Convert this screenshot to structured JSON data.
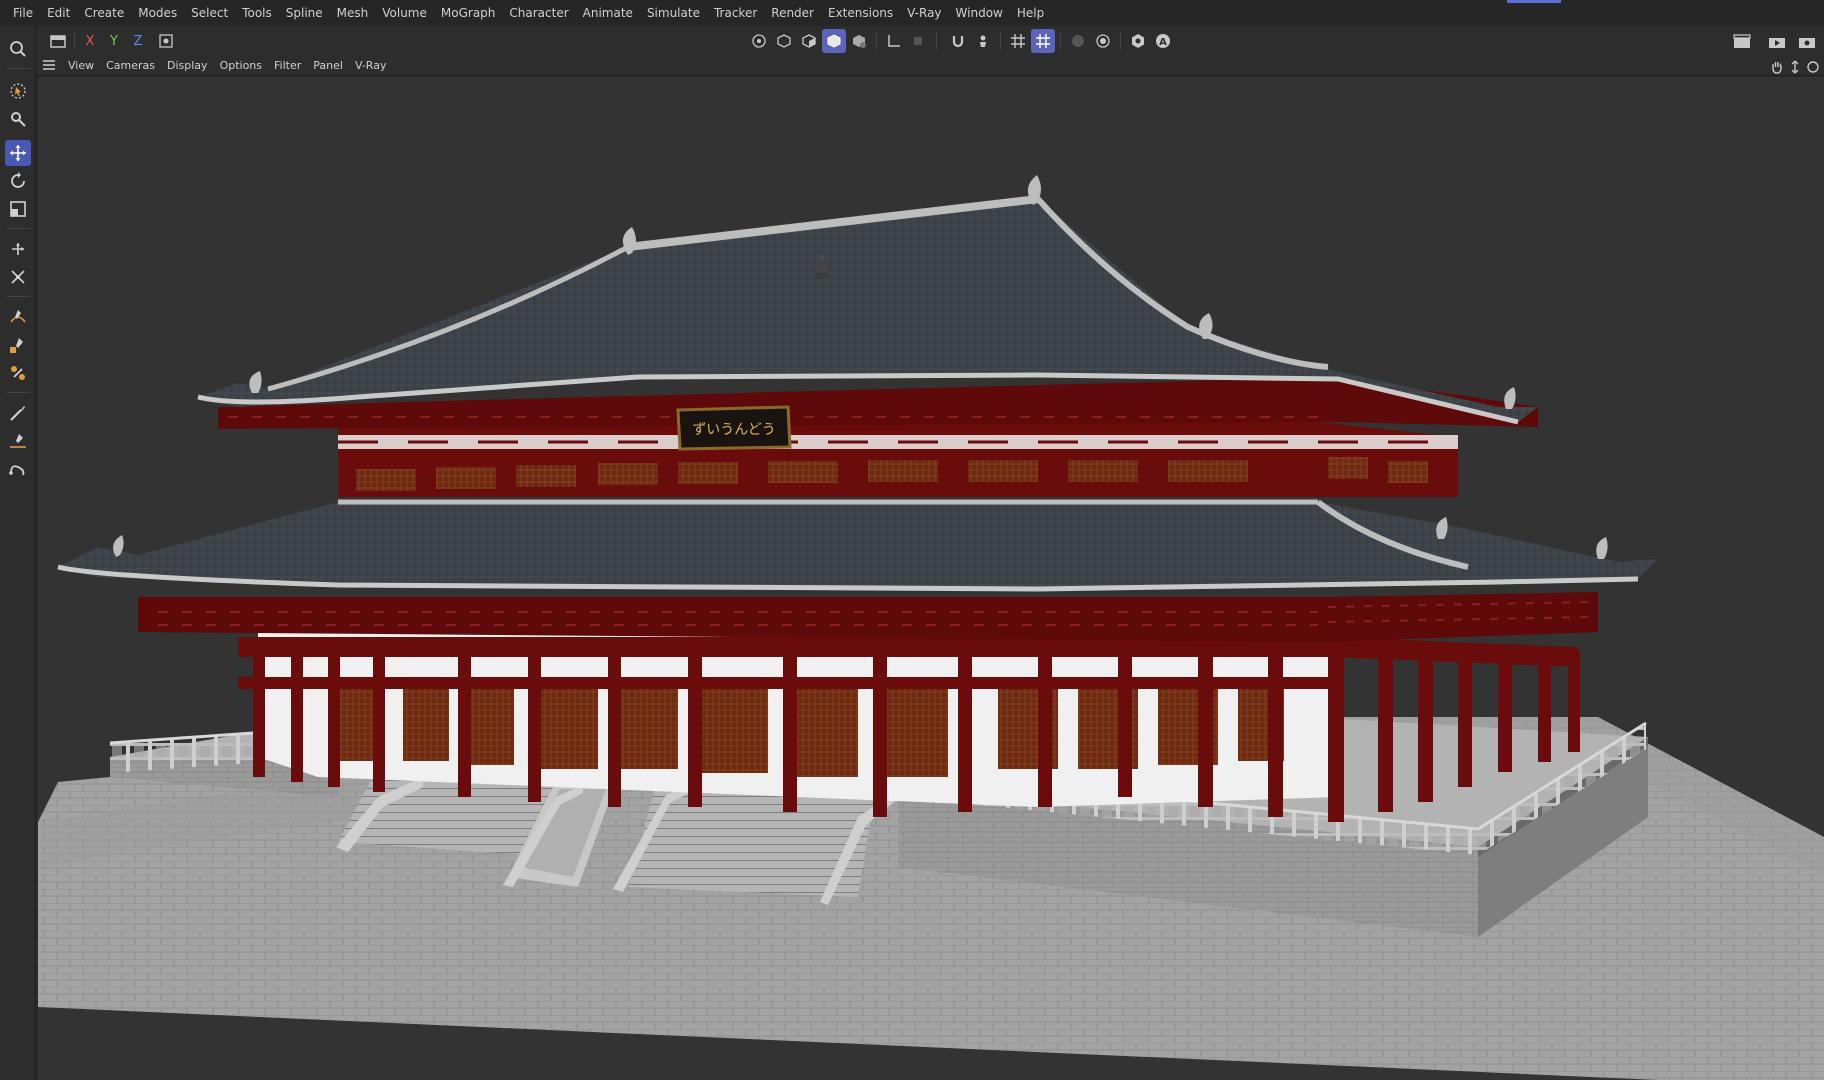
{
  "menubar": {
    "items": [
      "File",
      "Edit",
      "Create",
      "Modes",
      "Select",
      "Tools",
      "Spline",
      "Mesh",
      "Volume",
      "MoGraph",
      "Character",
      "Animate",
      "Simulate",
      "Tracker",
      "Render",
      "Extensions",
      "V-Ray",
      "Window",
      "Help"
    ]
  },
  "toolbar": {
    "axes": {
      "x": "X",
      "y": "Y",
      "z": "Z"
    }
  },
  "viewport_menu": {
    "items": [
      "View",
      "Cameras",
      "Display",
      "Options",
      "Filter",
      "Panel",
      "V-Ray"
    ]
  },
  "scene": {
    "signboard_text": "ずいうんどう"
  },
  "colors": {
    "accent": "#5b64b8",
    "bg": "#333333",
    "menubar": "#262626",
    "axis_x": "#e05a5a",
    "axis_y": "#7ac94f",
    "axis_z": "#5a8de0",
    "pillar": "#6b0c0c",
    "roof": "#3f444b"
  }
}
